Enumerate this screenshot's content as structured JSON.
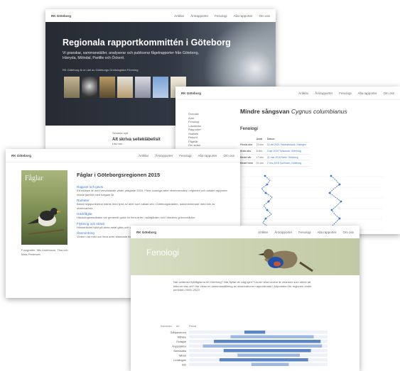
{
  "nav": {
    "brand": "RK Göteborg",
    "links": [
      "Artiklar",
      "Årsrapporter",
      "Fenologi",
      "Alla rapporter",
      "Om oss"
    ]
  },
  "home": {
    "title": "Regionala rapportkommittén i Göteborg",
    "subtitle": "Vi granskar, sammanställer, analyserar och publicerar fågelrapporter från Göteborg, Härryda, Mölndal, Partille och Öckerö.",
    "small_note": "RK Göteborg är en del av Göteborgs Ornitologiska Förening",
    "lower_label": "Senaste nytt",
    "lower_heading": "Alt skriva sellekläbelisit",
    "lower_sub": "Läs mer"
  },
  "species": {
    "name": "Mindre sångsvan",
    "latin": "Cygnus columbianus",
    "section": "Fenologi",
    "side_items": [
      "Översikt",
      "Arter",
      "Fenologi",
      "Lokalsidor",
      "Rapporter",
      "Statistik",
      "Rekord",
      "Fågelår",
      "Om sidan",
      "Kontakt"
    ],
    "table_header": [
      "",
      "Antal",
      "Datum"
    ],
    "table_rows": [
      [
        "Första obs",
        "23 obs",
        "12 okt 2021 Fiskebäcksvik, Hisingen"
      ],
      [
        "Sista obs",
        "8 obs",
        "3 apr 2019 Torslanda, Göteborg"
      ],
      [
        "Medel vår",
        "17 obs",
        "21 mar 2015 Säve, Göteborg"
      ],
      [
        "Medel höst",
        "21 obs",
        "2 nov 2018 Tjolöholm, Göteborg"
      ]
    ]
  },
  "report": {
    "title": "Fåglar i Göteborgsregionen 2015",
    "cover_title": "Fåglar",
    "caption": "Fotografier: Nils Andersson, Tina och Mats Pedersen",
    "sections": [
      {
        "heading": "Rapport och gävis",
        "text": "Ett mildare år med omväxlande väder präglade 2015. Flera ovanliga arter observerades i regionen och antalet rapporter ökade jämfört med tidigare år."
      },
      {
        "heading": "Rariteter",
        "text": "Bland höjdpunkterna märks flera fynd av arter som sällan ses i Göteborgstrakten, dokumenterade med foto av observatörer."
      },
      {
        "heading": "Häckfåglar",
        "text": "Häckningsresultaten var generellt goda för flera arter i skärgården och i stadens grönområden."
      },
      {
        "heading": "Flyttning och sträck",
        "text": "Höststräcket bjöd på stora antal gäss och vadare längs kusten under september och oktober."
      },
      {
        "heading": "Övervintring",
        "text": "Vintern var mild och flera arter stannade kvar längre än normalt."
      }
    ]
  },
  "phenology": {
    "title": "Fenologi",
    "intro": "När anländer flyttfåglarna till Göteborg? När flyttar de iväg igen? Under vilka veckor är chansen som störst att hitta en viss art? Här visas en sammanställning av observationer rapporterade i Artportalen för regionen under perioden 2000–2023.",
    "chart_head": [
      "Kolumnen",
      "Art",
      "Period"
    ],
    "species": [
      "Gråsparvkrona",
      "Blåhake",
      "Rödstjärt",
      "Ängspiplärka",
      "Stenskvätta",
      "Taltrast",
      "Lövsångare",
      "Gök"
    ]
  },
  "colors": {
    "hero_bg": "#262b33",
    "link": "#3a7bd5",
    "bar": "#5a86c6",
    "bar_light": "#9db9e2",
    "banner": "#ccd3b3"
  },
  "chart_data": {
    "type": "bar",
    "note": "Horizontal phenology bars, one row per species",
    "categories": [
      "Gråsparvkrona",
      "Blåhake",
      "Rödstjärt",
      "Ängspiplärka",
      "Stenskvätta",
      "Taltrast",
      "Lövsångare",
      "Gök"
    ],
    "ranges": [
      [
        0.4,
        0.55
      ],
      [
        0.3,
        0.9
      ],
      [
        0.18,
        0.95
      ],
      [
        0.1,
        0.96
      ],
      [
        0.25,
        0.88
      ],
      [
        0.35,
        0.8
      ],
      [
        0.22,
        0.86
      ],
      [
        0.45,
        0.72
      ]
    ]
  }
}
